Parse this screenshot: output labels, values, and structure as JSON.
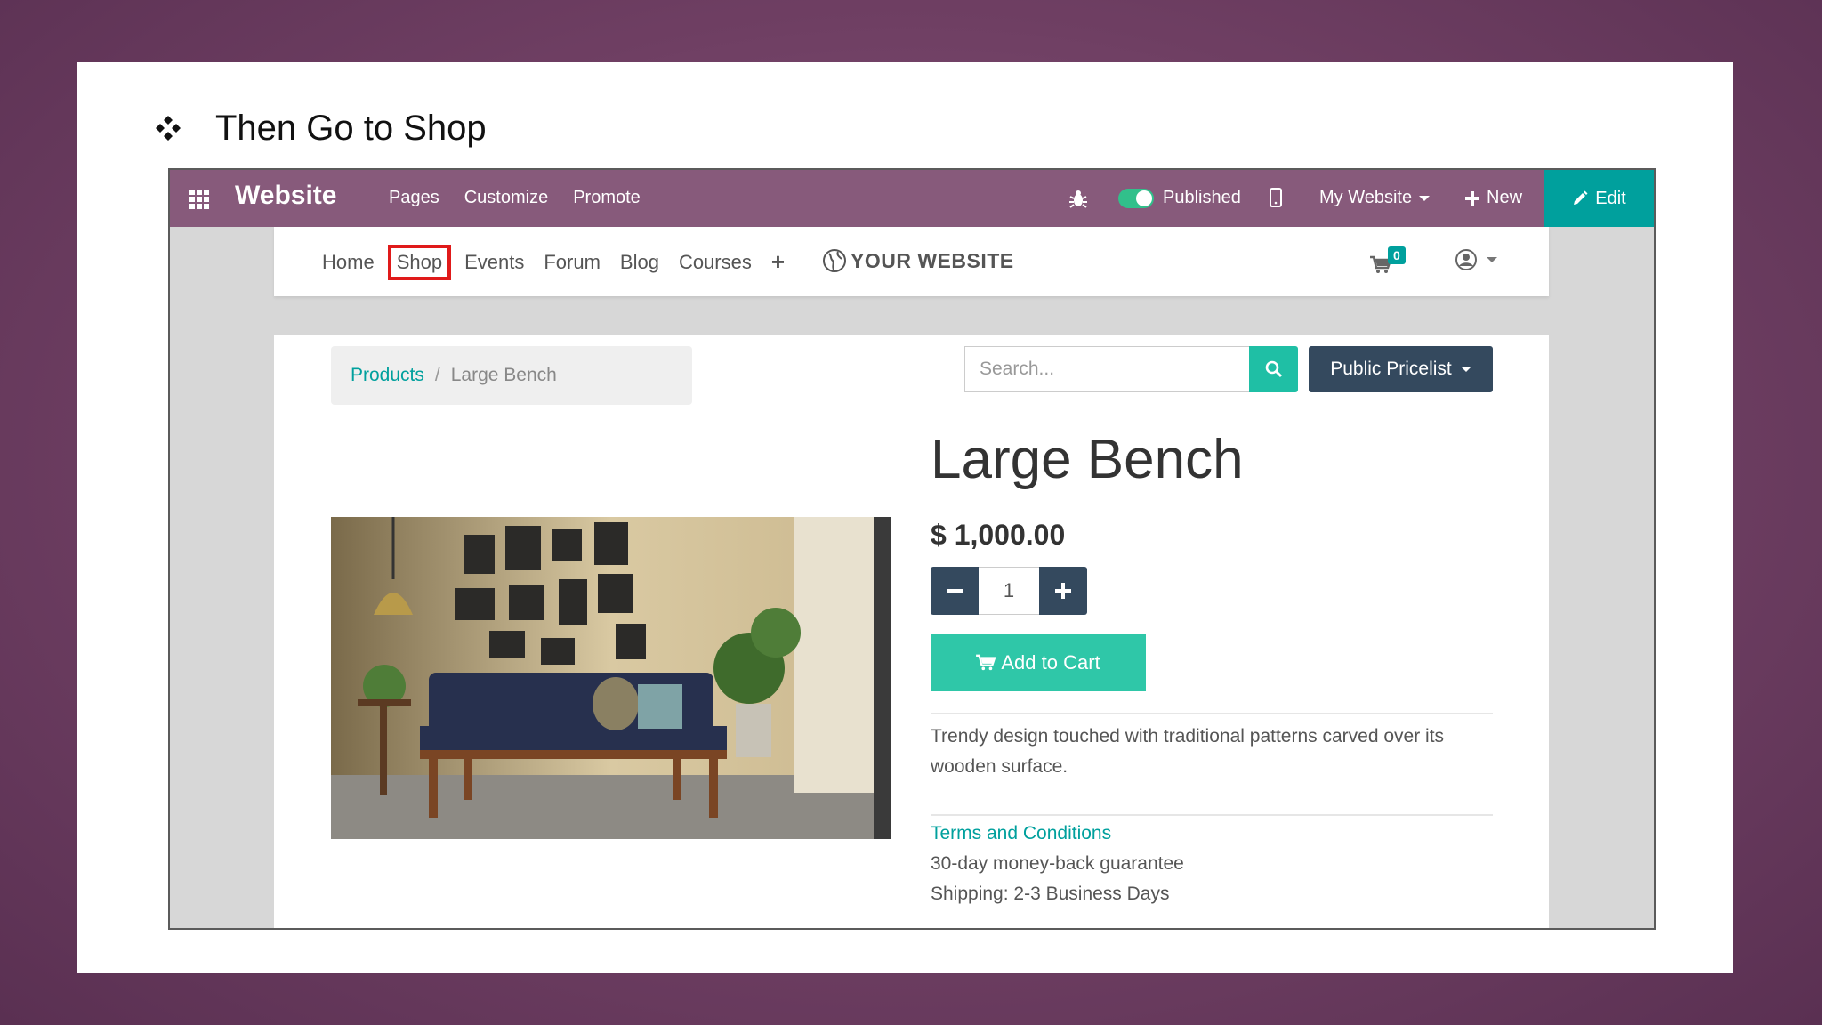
{
  "slide": {
    "heading": "Then Go to Shop",
    "bullet_icon": "four-diamond-bullet-icon"
  },
  "admin_bar": {
    "app_title": "Website",
    "menu": [
      "Pages",
      "Customize",
      "Promote"
    ],
    "published_label": "Published",
    "my_website_label": "My Website",
    "new_label": "New",
    "edit_label": "Edit"
  },
  "site_nav": {
    "items": [
      "Home",
      "Shop",
      "Events",
      "Forum",
      "Blog",
      "Courses"
    ],
    "active_item": "Shop",
    "plus": "+",
    "logo_text": "YOUR WEBSITE",
    "cart_count": "0"
  },
  "product_page": {
    "breadcrumb": {
      "link": "Products",
      "separator": "/",
      "current": "Large Bench"
    },
    "search_placeholder": "Search...",
    "pricelist_label": "Public Pricelist",
    "title": "Large Bench",
    "price": "$ 1,000.00",
    "quantity": "1",
    "add_to_cart_label": "Add to Cart",
    "description": "Trendy design touched with traditional patterns carved over its wooden surface.",
    "terms_link": "Terms and Conditions",
    "guarantee": "30-day money-back guarantee",
    "shipping": "Shipping: 2-3 Business Days"
  },
  "colors": {
    "odoo_purple": "#875a7b",
    "teal": "#00a09d",
    "add_to_cart": "#2fc7a8",
    "dark_button": "#34495e",
    "highlight_red": "#e01a1a"
  }
}
